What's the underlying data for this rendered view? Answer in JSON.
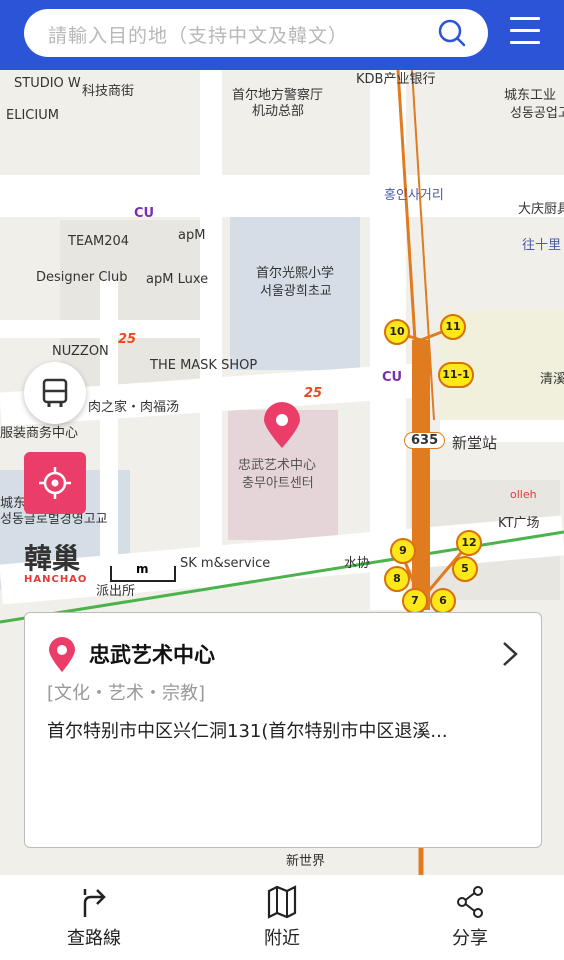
{
  "search": {
    "placeholder": "請輸入目的地（支持中文及韓文）"
  },
  "map": {
    "labels": {
      "studio": "STUDIO W",
      "kejishang": "科技商街",
      "kdb": "KDB产业银行",
      "chengdong": "城东工业",
      "chengdong_kr": "성동공업고",
      "elicium": "ELICIUM",
      "police": "首尔地方警察厅",
      "police2": "机动总部",
      "hongin": "홍인사거리",
      "team": "TEAM204",
      "apm": "apM",
      "designer": "Designer Club",
      "apmluxe": "apM Luxe",
      "school_cn": "首尔光熙小学",
      "school_kr": "서울광희초교",
      "daqing": "大庆厨具",
      "wangshili": "往十里",
      "nuzzon": "NUZZON",
      "mask": "THE MASK SHOP",
      "qing": "清溪",
      "roujia": "肉之家・肉福汤",
      "fuzhuang": "服装商务中心",
      "station": "新堂站",
      "route635": "635",
      "center_cn": "忠武艺术中心",
      "center_kr": "충무아트센터",
      "gaozhong": "城东高中",
      "gaozhong_kr": "성동글로벌경영고교",
      "kt": "KT广场",
      "olleh": "olleh",
      "sk": "SK m&service",
      "suixie": "水协",
      "paichusuo": "派出所",
      "xinshijie": "新世界",
      "cu1": "CU",
      "cu2": "CU",
      "gs1": "25",
      "gs2": "25"
    },
    "bubbles": [
      "10",
      "11",
      "11-1",
      "9",
      "12",
      "8",
      "5",
      "7",
      "6"
    ],
    "scale_label": "m"
  },
  "logo": {
    "cn": "韓巢",
    "en": "HANCHAO"
  },
  "card": {
    "title": "忠武艺术中心",
    "category": "[文化・艺术・宗教]",
    "address": "首尔特别市中区兴仁洞131(首尔特别市中区退溪..."
  },
  "bottom_tabs": [
    {
      "label": "查路線",
      "icon": "route-icon"
    },
    {
      "label": "附近",
      "icon": "map-icon"
    },
    {
      "label": "分享",
      "icon": "share-icon"
    }
  ],
  "colors": {
    "accent": "#2b54d7",
    "pin": "#ea3d6a",
    "subway": "#e07b1f"
  }
}
